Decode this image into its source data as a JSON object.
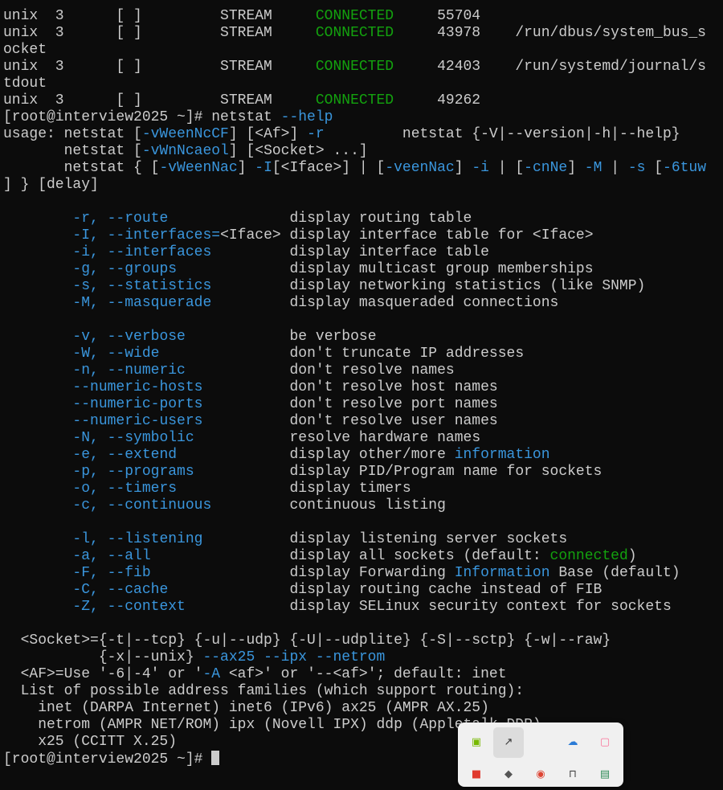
{
  "terminal": {
    "lines": [
      [
        {
          "t": "unix  3      [ ]         STREAM     "
        },
        {
          "t": "CONNECTED",
          "c": "gr"
        },
        {
          "t": "     55704"
        }
      ],
      [
        {
          "t": "unix  3      [ ]         STREAM     "
        },
        {
          "t": "CONNECTED",
          "c": "gr"
        },
        {
          "t": "     43978    /run/dbus/system_bus_s"
        }
      ],
      [
        {
          "t": "ocket"
        }
      ],
      [
        {
          "t": "unix  3      [ ]         STREAM     "
        },
        {
          "t": "CONNECTED",
          "c": "gr"
        },
        {
          "t": "     42403    /run/systemd/journal/s"
        }
      ],
      [
        {
          "t": "tdout"
        }
      ],
      [
        {
          "t": "unix  3      [ ]         STREAM     "
        },
        {
          "t": "CONNECTED",
          "c": "gr"
        },
        {
          "t": "     49262"
        }
      ],
      [
        {
          "t": "[root@interview2025 ~]# netstat "
        },
        {
          "t": "--help",
          "c": "hl"
        }
      ],
      [
        {
          "t": "usage: netstat ["
        },
        {
          "t": "-vWeenNcCF",
          "c": "hl"
        },
        {
          "t": "] [<Af>] "
        },
        {
          "t": "-r",
          "c": "hl"
        },
        {
          "t": "         netstat {-V|--version|-h|--help}"
        }
      ],
      [
        {
          "t": "       netstat ["
        },
        {
          "t": "-vWnNcaeol",
          "c": "hl"
        },
        {
          "t": "] [<Socket> ...]"
        }
      ],
      [
        {
          "t": "       netstat { ["
        },
        {
          "t": "-vWeenNac",
          "c": "hl"
        },
        {
          "t": "] "
        },
        {
          "t": "-I",
          "c": "hl"
        },
        {
          "t": "[<Iface>] | ["
        },
        {
          "t": "-veenNac",
          "c": "hl"
        },
        {
          "t": "] "
        },
        {
          "t": "-i",
          "c": "hl"
        },
        {
          "t": " | ["
        },
        {
          "t": "-cnNe",
          "c": "hl"
        },
        {
          "t": "] "
        },
        {
          "t": "-M",
          "c": "hl"
        },
        {
          "t": " | "
        },
        {
          "t": "-s",
          "c": "hl"
        },
        {
          "t": " ["
        },
        {
          "t": "-6tuw",
          "c": "hl"
        }
      ],
      [
        {
          "t": "] } [delay]"
        }
      ],
      [],
      [
        {
          "t": "        "
        },
        {
          "t": "-r, --route",
          "c": "hl"
        },
        {
          "t": "              display routing table"
        }
      ],
      [
        {
          "t": "        "
        },
        {
          "t": "-I, --interfaces=",
          "c": "hl"
        },
        {
          "t": "<Iface> display interface table for <Iface>"
        }
      ],
      [
        {
          "t": "        "
        },
        {
          "t": "-i, --interfaces",
          "c": "hl"
        },
        {
          "t": "         display interface table"
        }
      ],
      [
        {
          "t": "        "
        },
        {
          "t": "-g, --groups",
          "c": "hl"
        },
        {
          "t": "             display multicast group memberships"
        }
      ],
      [
        {
          "t": "        "
        },
        {
          "t": "-s, --statistics",
          "c": "hl"
        },
        {
          "t": "         display networking statistics (like SNMP)"
        }
      ],
      [
        {
          "t": "        "
        },
        {
          "t": "-M, --masquerade",
          "c": "hl"
        },
        {
          "t": "         display masqueraded connections"
        }
      ],
      [],
      [
        {
          "t": "        "
        },
        {
          "t": "-v, --verbose",
          "c": "hl"
        },
        {
          "t": "            be verbose"
        }
      ],
      [
        {
          "t": "        "
        },
        {
          "t": "-W, --wide",
          "c": "hl"
        },
        {
          "t": "               don't truncate IP addresses"
        }
      ],
      [
        {
          "t": "        "
        },
        {
          "t": "-n, --numeric",
          "c": "hl"
        },
        {
          "t": "            don't resolve names"
        }
      ],
      [
        {
          "t": "        "
        },
        {
          "t": "--numeric-hosts",
          "c": "hl"
        },
        {
          "t": "          don't resolve host names"
        }
      ],
      [
        {
          "t": "        "
        },
        {
          "t": "--numeric-ports",
          "c": "hl"
        },
        {
          "t": "          don't resolve port names"
        }
      ],
      [
        {
          "t": "        "
        },
        {
          "t": "--numeric-users",
          "c": "hl"
        },
        {
          "t": "          don't resolve user names"
        }
      ],
      [
        {
          "t": "        "
        },
        {
          "t": "-N, --symbolic",
          "c": "hl"
        },
        {
          "t": "           resolve hardware names"
        }
      ],
      [
        {
          "t": "        "
        },
        {
          "t": "-e, --extend",
          "c": "hl"
        },
        {
          "t": "             display other/more "
        },
        {
          "t": "information",
          "c": "hl"
        }
      ],
      [
        {
          "t": "        "
        },
        {
          "t": "-p, --programs",
          "c": "hl"
        },
        {
          "t": "           display PID/Program name for sockets"
        }
      ],
      [
        {
          "t": "        "
        },
        {
          "t": "-o, --timers",
          "c": "hl"
        },
        {
          "t": "             display timers"
        }
      ],
      [
        {
          "t": "        "
        },
        {
          "t": "-c, --continuous",
          "c": "hl"
        },
        {
          "t": "         continuous listing"
        }
      ],
      [],
      [
        {
          "t": "        "
        },
        {
          "t": "-l, --listening",
          "c": "hl"
        },
        {
          "t": "          display listening server sockets"
        }
      ],
      [
        {
          "t": "        "
        },
        {
          "t": "-a, --all",
          "c": "hl"
        },
        {
          "t": "                display all sockets (default: "
        },
        {
          "t": "connected",
          "c": "gr"
        },
        {
          "t": ")"
        }
      ],
      [
        {
          "t": "        "
        },
        {
          "t": "-F, --fib",
          "c": "hl"
        },
        {
          "t": "                display Forwarding "
        },
        {
          "t": "Information",
          "c": "hl"
        },
        {
          "t": " Base (default)"
        }
      ],
      [
        {
          "t": "        "
        },
        {
          "t": "-C, --cache",
          "c": "hl"
        },
        {
          "t": "              display routing cache instead of FIB"
        }
      ],
      [
        {
          "t": "        "
        },
        {
          "t": "-Z, --context",
          "c": "hl"
        },
        {
          "t": "            display SELinux security context for sockets"
        }
      ],
      [],
      [
        {
          "t": "  <Socket>={-t|--tcp} {-u|--udp} {-U|--udplite} {-S|--sctp} {-w|--raw}"
        }
      ],
      [
        {
          "t": "           {-x|--unix} "
        },
        {
          "t": "--ax25 --ipx --netrom",
          "c": "hl"
        }
      ],
      [
        {
          "t": "  <AF>=Use '-6|-4' or '"
        },
        {
          "t": "-A",
          "c": "hl"
        },
        {
          "t": " <af>' or '--<af>'; default: inet"
        }
      ],
      [
        {
          "t": "  List of possible address families (which support routing):"
        }
      ],
      [
        {
          "t": "    inet (DARPA Internet) inet6 (IPv6) ax25 (AMPR AX.25)"
        }
      ],
      [
        {
          "t": "    netrom (AMPR NET/ROM) ipx (Novell IPX) ddp (Appletalk DDP)"
        }
      ],
      [
        {
          "t": "    x25 (CCITT X.25)"
        }
      ],
      [
        {
          "t": "[root@interview2025 ~]# "
        }
      ]
    ]
  },
  "colors": {
    "background": "#0c0c0c",
    "text": "#cccccc",
    "highlight": "#3a96dd",
    "connected": "#13a10e"
  },
  "tray": {
    "icons": [
      {
        "name": "nvidia-icon",
        "glyph": "▣",
        "color": "#76b900"
      },
      {
        "name": "pen-icon",
        "glyph": "↗",
        "color": "#333333"
      },
      {
        "name": "cloud-sync-icon",
        "glyph": "☁",
        "color": "#2b7bd6"
      },
      {
        "name": "bilibili-icon",
        "glyph": "▢",
        "color": "#fb7299"
      },
      {
        "name": "red-app-icon",
        "glyph": "■",
        "color": "#e03a2f"
      },
      {
        "name": "gray-app-icon",
        "glyph": "◆",
        "color": "#555555"
      },
      {
        "name": "chrome-icon",
        "glyph": "◉",
        "color": "#dd4433"
      },
      {
        "name": "usb-icon",
        "glyph": "⊓",
        "color": "#444444"
      },
      {
        "name": "chart-app-icon",
        "glyph": "▤",
        "color": "#2e8b57"
      }
    ]
  }
}
